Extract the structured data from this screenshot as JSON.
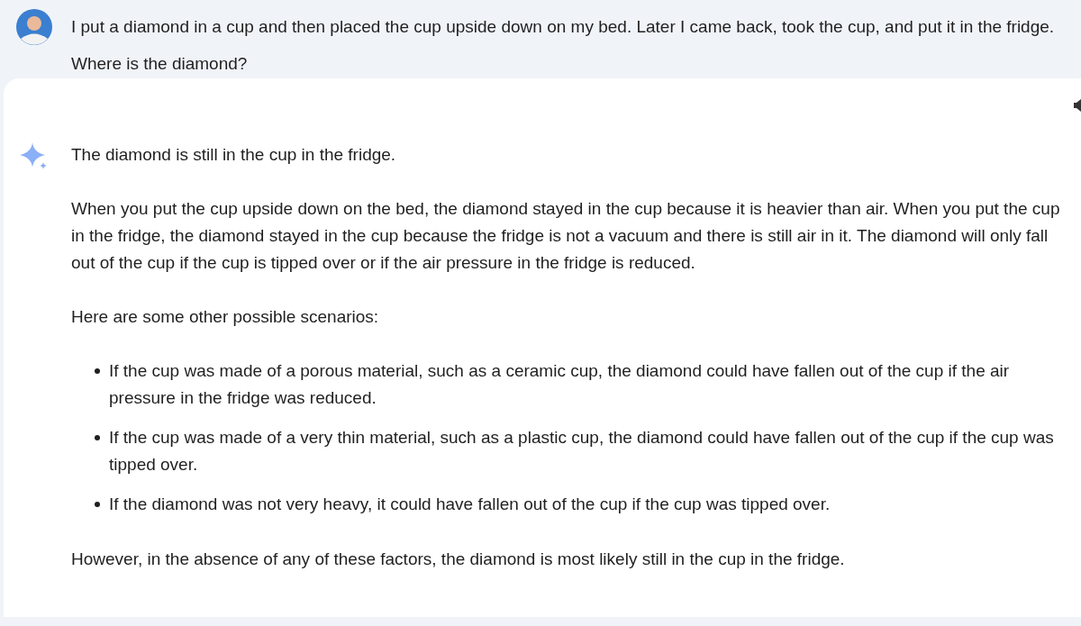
{
  "prompt": {
    "text": "I put a diamond in a cup and then placed the cup upside down on my bed. Later I came back, took the cup, and put it in the fridge. Where is the diamond?"
  },
  "response": {
    "blocks": [
      {
        "kind": "paragraph",
        "text": "The diamond is still in the cup in the fridge."
      },
      {
        "kind": "paragraph",
        "text": "When you put the cup upside down on the bed, the diamond stayed in the cup because it is heavier than air. When you put the cup in the fridge, the diamond stayed in the cup because the fridge is not a vacuum and there is still air in it. The diamond will only fall out of the cup if the cup is tipped over or if the air pressure in the fridge is reduced."
      },
      {
        "kind": "paragraph",
        "text": "Here are some other possible scenarios:"
      },
      {
        "kind": "list",
        "items": [
          "If the cup was made of a porous material, such as a ceramic cup, the diamond could have fallen out of the cup if the air pressure in the fridge was reduced.",
          "If the cup was made of a very thin material, such as a plastic cup, the diamond could have fallen out of the cup if the cup was tipped over.",
          "If the diamond was not very heavy, it could have fallen out of the cup if the cup was tipped over."
        ]
      },
      {
        "kind": "paragraph",
        "text": "However, in the absence of any of these factors, the diamond is most likely still in the cup in the fridge."
      }
    ]
  }
}
